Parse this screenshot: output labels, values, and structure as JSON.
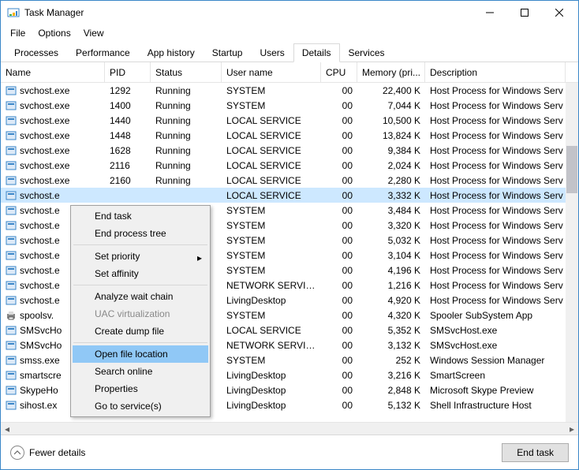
{
  "window": {
    "title": "Task Manager"
  },
  "menubar": [
    "File",
    "Options",
    "View"
  ],
  "tabs": [
    "Processes",
    "Performance",
    "App history",
    "Startup",
    "Users",
    "Details",
    "Services"
  ],
  "active_tab": "Details",
  "columns": {
    "name": "Name",
    "pid": "PID",
    "status": "Status",
    "user": "User name",
    "cpu": "CPU",
    "mem": "Memory (pri...",
    "desc": "Description"
  },
  "rows": [
    {
      "name": "svchost.exe",
      "pid": "1292",
      "status": "Running",
      "user": "SYSTEM",
      "cpu": "00",
      "mem": "22,400 K",
      "desc": "Host Process for Windows Serv"
    },
    {
      "name": "svchost.exe",
      "pid": "1400",
      "status": "Running",
      "user": "SYSTEM",
      "cpu": "00",
      "mem": "7,044 K",
      "desc": "Host Process for Windows Serv"
    },
    {
      "name": "svchost.exe",
      "pid": "1440",
      "status": "Running",
      "user": "LOCAL SERVICE",
      "cpu": "00",
      "mem": "10,500 K",
      "desc": "Host Process for Windows Serv"
    },
    {
      "name": "svchost.exe",
      "pid": "1448",
      "status": "Running",
      "user": "LOCAL SERVICE",
      "cpu": "00",
      "mem": "13,824 K",
      "desc": "Host Process for Windows Serv"
    },
    {
      "name": "svchost.exe",
      "pid": "1628",
      "status": "Running",
      "user": "LOCAL SERVICE",
      "cpu": "00",
      "mem": "9,384 K",
      "desc": "Host Process for Windows Serv"
    },
    {
      "name": "svchost.exe",
      "pid": "2116",
      "status": "Running",
      "user": "LOCAL SERVICE",
      "cpu": "00",
      "mem": "2,024 K",
      "desc": "Host Process for Windows Serv"
    },
    {
      "name": "svchost.exe",
      "pid": "2160",
      "status": "Running",
      "user": "LOCAL SERVICE",
      "cpu": "00",
      "mem": "2,280 K",
      "desc": "Host Process for Windows Serv"
    },
    {
      "name": "svchost.e",
      "pid": "",
      "status": "",
      "user": "LOCAL SERVICE",
      "cpu": "00",
      "mem": "3,332 K",
      "desc": "Host Process for Windows Serv",
      "selected": true
    },
    {
      "name": "svchost.e",
      "pid": "",
      "status": "",
      "user": "SYSTEM",
      "cpu": "00",
      "mem": "3,484 K",
      "desc": "Host Process for Windows Serv"
    },
    {
      "name": "svchost.e",
      "pid": "",
      "status": "",
      "user": "SYSTEM",
      "cpu": "00",
      "mem": "3,320 K",
      "desc": "Host Process for Windows Serv"
    },
    {
      "name": "svchost.e",
      "pid": "",
      "status": "",
      "user": "SYSTEM",
      "cpu": "00",
      "mem": "5,032 K",
      "desc": "Host Process for Windows Serv"
    },
    {
      "name": "svchost.e",
      "pid": "",
      "status": "",
      "user": "SYSTEM",
      "cpu": "00",
      "mem": "3,104 K",
      "desc": "Host Process for Windows Serv"
    },
    {
      "name": "svchost.e",
      "pid": "",
      "status": "",
      "user": "SYSTEM",
      "cpu": "00",
      "mem": "4,196 K",
      "desc": "Host Process for Windows Serv"
    },
    {
      "name": "svchost.e",
      "pid": "",
      "status": "",
      "user": "NETWORK SERVICE",
      "cpu": "00",
      "mem": "1,216 K",
      "desc": "Host Process for Windows Serv"
    },
    {
      "name": "svchost.e",
      "pid": "",
      "status": "",
      "user": "LivingDesktop",
      "cpu": "00",
      "mem": "4,920 K",
      "desc": "Host Process for Windows Serv"
    },
    {
      "name": "spoolsv.",
      "pid": "",
      "status": "",
      "user": "SYSTEM",
      "cpu": "00",
      "mem": "4,320 K",
      "desc": "Spooler SubSystem App",
      "icon": "printer"
    },
    {
      "name": "SMSvcHo",
      "pid": "",
      "status": "",
      "user": "LOCAL SERVICE",
      "cpu": "00",
      "mem": "5,352 K",
      "desc": "SMSvcHost.exe"
    },
    {
      "name": "SMSvcHo",
      "pid": "",
      "status": "",
      "user": "NETWORK SERVICE",
      "cpu": "00",
      "mem": "3,132 K",
      "desc": "SMSvcHost.exe"
    },
    {
      "name": "smss.exe",
      "pid": "",
      "status": "",
      "user": "SYSTEM",
      "cpu": "00",
      "mem": "252 K",
      "desc": "Windows Session Manager"
    },
    {
      "name": "smartscre",
      "pid": "",
      "status": "",
      "user": "LivingDesktop",
      "cpu": "00",
      "mem": "3,216 K",
      "desc": "SmartScreen"
    },
    {
      "name": "SkypeHo",
      "pid": "",
      "status": "",
      "user": "LivingDesktop",
      "cpu": "00",
      "mem": "2,848 K",
      "desc": "Microsoft Skype Preview"
    },
    {
      "name": "sihost.ex",
      "pid": "",
      "status": "",
      "user": "LivingDesktop",
      "cpu": "00",
      "mem": "5,132 K",
      "desc": "Shell Infrastructure Host"
    }
  ],
  "context_menu": {
    "items": [
      {
        "label": "End task"
      },
      {
        "label": "End process tree"
      },
      {
        "sep": true
      },
      {
        "label": "Set priority",
        "submenu": true
      },
      {
        "label": "Set affinity"
      },
      {
        "sep": true
      },
      {
        "label": "Analyze wait chain"
      },
      {
        "label": "UAC virtualization",
        "disabled": true
      },
      {
        "label": "Create dump file"
      },
      {
        "sep": true
      },
      {
        "label": "Open file location",
        "highlight": true
      },
      {
        "label": "Search online"
      },
      {
        "label": "Properties"
      },
      {
        "label": "Go to service(s)"
      }
    ]
  },
  "footer": {
    "fewer": "Fewer details",
    "end_task": "End task"
  }
}
